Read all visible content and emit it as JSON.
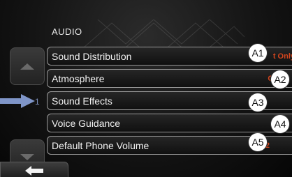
{
  "screen": {
    "title": "AUDIO",
    "rows": [
      {
        "label": "Sound Distribution",
        "value": "t Only"
      },
      {
        "label": "Atmosphere",
        "value": "Cu"
      },
      {
        "label": "Sound Effects",
        "value": ""
      },
      {
        "label": "Voice Guidance",
        "value": ""
      },
      {
        "label": "Default Phone Volume",
        "value": "12"
      }
    ],
    "side_number": "1"
  },
  "callouts": [
    "A1",
    "A2",
    "A3",
    "A4",
    "A5"
  ],
  "icons": {
    "scroll_up": "triangle-up-icon",
    "scroll_down": "triangle-down-icon",
    "back": "back-arrow-icon",
    "pointer": "pointer-arrow-icon"
  },
  "colors": {
    "value_text": "#d2451e",
    "row_border": "#9a9a9a",
    "pointer_arrow": "#7f95c8"
  }
}
